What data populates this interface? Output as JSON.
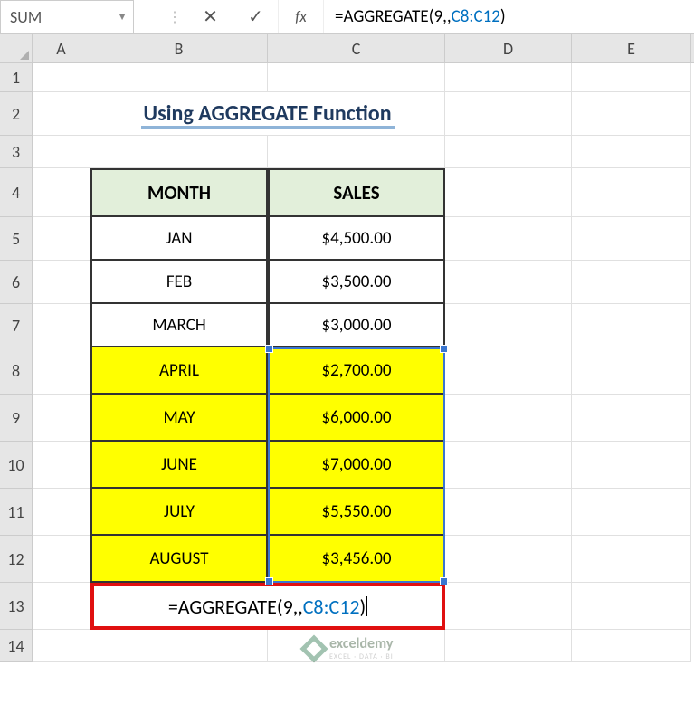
{
  "nameBox": "SUM",
  "formulaBar": {
    "eq": "=",
    "fn": "AGGREGATE",
    "open": "(",
    "arg1": "9",
    "comma1": ",,",
    "ref": "C8:C12",
    "close": ")"
  },
  "columns": [
    "A",
    "B",
    "C",
    "D",
    "E"
  ],
  "rows": [
    "1",
    "2",
    "3",
    "4",
    "5",
    "6",
    "7",
    "8",
    "9",
    "10",
    "11",
    "12",
    "13",
    "14"
  ],
  "title": "Using AGGREGATE Function",
  "headers": {
    "month": "MONTH",
    "sales": "SALES"
  },
  "data": [
    {
      "month": "JAN",
      "sales": "$4,500.00",
      "hl": false
    },
    {
      "month": "FEB",
      "sales": "$3,500.00",
      "hl": false
    },
    {
      "month": "MARCH",
      "sales": "$3,000.00",
      "hl": false
    },
    {
      "month": "APRIL",
      "sales": "$2,700.00",
      "hl": true
    },
    {
      "month": "MAY",
      "sales": "$6,000.00",
      "hl": true
    },
    {
      "month": "JUNE",
      "sales": "$7,000.00",
      "hl": true
    },
    {
      "month": "JULY",
      "sales": "$5,550.00",
      "hl": true
    },
    {
      "month": "AUGUST",
      "sales": "$3,456.00",
      "hl": true
    }
  ],
  "formulaCell": {
    "eq": "=",
    "fn": "AGGREGATE",
    "open": "(",
    "arg1": "9",
    "comma1": ",,",
    "ref": "C8:C12",
    "close": ")"
  },
  "watermark": {
    "brand": "exceldemy",
    "tag": "EXCEL · DATA · BI"
  }
}
